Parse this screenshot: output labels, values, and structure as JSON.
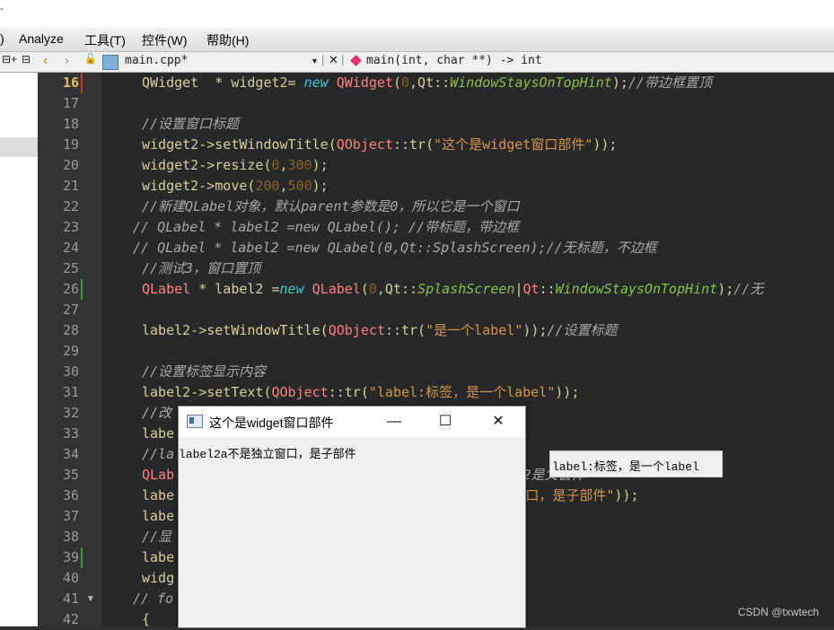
{
  "menubar": {
    "items": [
      ")",
      "Analyze",
      "工具(T)",
      "控件(W)",
      "帮助(H)"
    ]
  },
  "toolbar": {
    "file_tab": "main.cpp*",
    "function_combo": "main(int, char **) -> int"
  },
  "editor": {
    "lines": [
      {
        "n": "16",
        "segs": [
          [
            "fn",
            "QWidget"
          ],
          [
            "",
            "  * widget2= "
          ],
          [
            "kw",
            "new"
          ],
          [
            "",
            ""
          ],
          [
            "ty",
            " QWidget"
          ],
          [
            "",
            "("
          ],
          [
            "num",
            "0"
          ],
          [
            "",
            ",Qt::"
          ],
          [
            "en",
            "WindowStaysOnTopHint"
          ],
          [
            "",
            ");"
          ],
          [
            "cm",
            "//带边框置顶"
          ]
        ]
      },
      {
        "n": "17",
        "segs": []
      },
      {
        "n": "18",
        "segs": [
          [
            "cm",
            "//设置窗口标题"
          ]
        ]
      },
      {
        "n": "19",
        "segs": [
          [
            "",
            "widget2->setWindowTitle("
          ],
          [
            "ty",
            "QObject"
          ],
          [
            "",
            "::tr("
          ],
          [
            "str",
            "\"这个是widget窗口部件\""
          ],
          [
            "",
            "));"
          ]
        ]
      },
      {
        "n": "20",
        "segs": [
          [
            "",
            "widget2->resize("
          ],
          [
            "num",
            "0"
          ],
          [
            "",
            ","
          ],
          [
            "num",
            "300"
          ],
          [
            "",
            ");"
          ]
        ]
      },
      {
        "n": "21",
        "segs": [
          [
            "",
            "widget2->move("
          ],
          [
            "num",
            "200"
          ],
          [
            "",
            ","
          ],
          [
            "num",
            "500"
          ],
          [
            "",
            ");"
          ]
        ]
      },
      {
        "n": "22",
        "segs": [
          [
            "cm",
            "//新建QLabel对象，默认parent参数是0，所以它是一个窗口"
          ]
        ]
      },
      {
        "n": "23",
        "segs": [
          [
            "cm",
            "// QLabel * label2 =new QLabel(); //带标题，带边框"
          ]
        ]
      },
      {
        "n": "24",
        "segs": [
          [
            "cm",
            "// QLabel * label2 =new QLabel(0,Qt::SplashScreen);//无标题，不边框"
          ]
        ]
      },
      {
        "n": "25",
        "segs": [
          [
            "cm",
            "//测试3，窗口置顶"
          ]
        ]
      },
      {
        "n": "26",
        "segs": [
          [
            "ty",
            "QLabel"
          ],
          [
            "",
            ""
          ],
          [
            "fn",
            " * label2 ="
          ],
          [
            "kw",
            "new"
          ],
          [
            "ty",
            " QLabel"
          ],
          [
            "",
            "("
          ],
          [
            "num",
            "0"
          ],
          [
            "",
            ",Qt::"
          ],
          [
            "en",
            "SplashScreen"
          ],
          [
            "",
            "|"
          ],
          [
            "ty",
            "Qt"
          ],
          [
            "",
            "::"
          ],
          [
            "en",
            "WindowStaysOnTopHint"
          ],
          [
            "",
            ");"
          ],
          [
            "cm",
            "//无"
          ]
        ]
      },
      {
        "n": "27",
        "segs": []
      },
      {
        "n": "28",
        "segs": [
          [
            "",
            "label2->setWindowTitle("
          ],
          [
            "ty",
            "QObject"
          ],
          [
            "",
            "::tr("
          ],
          [
            "str",
            "\"是一个label\""
          ],
          [
            "",
            "));"
          ],
          [
            "cm",
            "//设置标题"
          ]
        ]
      },
      {
        "n": "29",
        "segs": []
      },
      {
        "n": "30",
        "segs": [
          [
            "cm",
            "//设置标签显示内容"
          ]
        ]
      },
      {
        "n": "31",
        "segs": [
          [
            "",
            "label2->setText("
          ],
          [
            "ty",
            "QObject"
          ],
          [
            "",
            "::tr("
          ],
          [
            "str",
            "\"label:标签，是一个label\""
          ],
          [
            "",
            "));"
          ]
        ]
      },
      {
        "n": "32",
        "segs": [
          [
            "cm",
            "//改"
          ]
        ]
      },
      {
        "n": "33",
        "segs": [
          [
            "",
            "labe"
          ]
        ]
      },
      {
        "n": "34",
        "segs": [
          [
            "cm",
            "//la"
          ]
        ]
      },
      {
        "n": "35",
        "segs": [
          [
            "ty",
            "QLab"
          ],
          [
            "",
            "                                        "
          ],
          [
            "cm",
            "ets2是父窗体"
          ]
        ]
      },
      {
        "n": "36",
        "segs": [
          [
            "",
            "labe"
          ],
          [
            "",
            "                                        "
          ],
          [
            "str",
            "立窗口，是子部件\""
          ],
          [
            "",
            "));"
          ]
        ]
      },
      {
        "n": "37",
        "segs": [
          [
            "",
            "labe"
          ]
        ]
      },
      {
        "n": "38",
        "segs": [
          [
            "cm",
            "//显"
          ]
        ]
      },
      {
        "n": "39",
        "segs": [
          [
            "",
            "labe"
          ]
        ]
      },
      {
        "n": "40",
        "segs": [
          [
            "",
            "widg"
          ]
        ]
      },
      {
        "n": "41",
        "segs": [
          [
            "cm",
            "// fo"
          ]
        ]
      },
      {
        "n": "42",
        "segs": [
          [
            "",
            "{"
          ]
        ]
      }
    ]
  },
  "widget_window": {
    "title": "这个是widget窗口部件",
    "minimize": "—",
    "maximize": "☐",
    "close": "✕",
    "child_label": "label2a不是独立窗口，是子部件"
  },
  "splash_label": {
    "text": "label:标签，是一个label"
  },
  "watermark": "CSDN @txwtech"
}
